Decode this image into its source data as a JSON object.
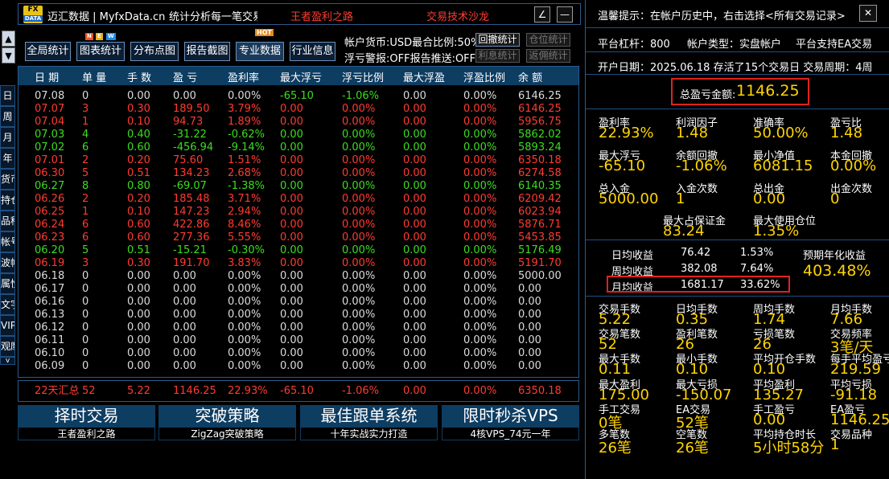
{
  "titlebar": {
    "logo_top": "FX",
    "logo_bottom": "DATA",
    "app_title": "迈汇数据 | MyfxData.cn",
    "subtitle": "统计分析每一笔交易",
    "link1": "王者盈利之路",
    "link2": "交易技术沙龙",
    "btn_edit": "∠",
    "btn_min": "—"
  },
  "nav": {
    "up": "▲",
    "down": "▼"
  },
  "toolbar": {
    "buttons": [
      "全局统计",
      "图表统计",
      "分布点图",
      "报告截图",
      "专业数据",
      "行业信息"
    ],
    "new_badge": [
      "N",
      "E",
      "W"
    ],
    "hot_badge": "HOT",
    "currency_text": "帐户货币:USD最合比例:50%",
    "withdraw_btn": "回撤统计",
    "position_btn": "仓位统计",
    "alert_text": "浮亏警报:OFF报告推送:OFF",
    "interest_btn": "利息统计",
    "commission_btn": "返佣统计"
  },
  "side_tabs": [
    "日",
    "周",
    "月",
    "年",
    "货币",
    "持仓",
    "品种",
    "帐号",
    "波幅",
    "属性",
    "文字",
    "VIP",
    "观摩"
  ],
  "side_tabs_more": "v",
  "table": {
    "headers": [
      "日 期",
      "单 量",
      "手 数",
      "盈 亏",
      "盈利率",
      "最大浮亏",
      "浮亏比例",
      "最大浮盈",
      "浮盈比例",
      "余 额"
    ],
    "rows": [
      {
        "c": "w",
        "v": [
          "07.08",
          "0",
          "0.00",
          "0.00",
          "0.00%",
          "-65.10",
          "-1.06%",
          "0.00",
          "0.00%",
          "6146.25"
        ],
        "g5": true
      },
      {
        "c": "r",
        "v": [
          "07.07",
          "3",
          "0.30",
          "189.50",
          "3.79%",
          "0.00",
          "0.00%",
          "0.00",
          "0.00%",
          "6146.25"
        ]
      },
      {
        "c": "r",
        "v": [
          "07.04",
          "1",
          "0.10",
          "94.73",
          "1.89%",
          "0.00",
          "0.00%",
          "0.00",
          "0.00%",
          "5956.75"
        ]
      },
      {
        "c": "g",
        "v": [
          "07.03",
          "4",
          "0.40",
          "-31.22",
          "-0.62%",
          "0.00",
          "0.00%",
          "0.00",
          "0.00%",
          "5862.02"
        ]
      },
      {
        "c": "g",
        "v": [
          "07.02",
          "6",
          "0.60",
          "-456.94",
          "-9.14%",
          "0.00",
          "0.00%",
          "0.00",
          "0.00%",
          "5893.24"
        ]
      },
      {
        "c": "r",
        "v": [
          "07.01",
          "2",
          "0.20",
          "75.60",
          "1.51%",
          "0.00",
          "0.00%",
          "0.00",
          "0.00%",
          "6350.18"
        ]
      },
      {
        "c": "r",
        "v": [
          "06.30",
          "5",
          "0.51",
          "134.23",
          "2.68%",
          "0.00",
          "0.00%",
          "0.00",
          "0.00%",
          "6274.58"
        ]
      },
      {
        "c": "g",
        "v": [
          "06.27",
          "8",
          "0.80",
          "-69.07",
          "-1.38%",
          "0.00",
          "0.00%",
          "0.00",
          "0.00%",
          "6140.35"
        ]
      },
      {
        "c": "r",
        "v": [
          "06.26",
          "2",
          "0.20",
          "185.48",
          "3.71%",
          "0.00",
          "0.00%",
          "0.00",
          "0.00%",
          "6209.42"
        ]
      },
      {
        "c": "r",
        "v": [
          "06.25",
          "1",
          "0.10",
          "147.23",
          "2.94%",
          "0.00",
          "0.00%",
          "0.00",
          "0.00%",
          "6023.94"
        ]
      },
      {
        "c": "r",
        "v": [
          "06.24",
          "6",
          "0.60",
          "422.86",
          "8.46%",
          "0.00",
          "0.00%",
          "0.00",
          "0.00%",
          "5876.71"
        ]
      },
      {
        "c": "r",
        "v": [
          "06.23",
          "6",
          "0.60",
          "277.36",
          "5.55%",
          "0.00",
          "0.00%",
          "0.00",
          "0.00%",
          "5453.85"
        ]
      },
      {
        "c": "g",
        "v": [
          "06.20",
          "5",
          "0.51",
          "-15.21",
          "-0.30%",
          "0.00",
          "0.00%",
          "0.00",
          "0.00%",
          "5176.49"
        ]
      },
      {
        "c": "r",
        "v": [
          "06.19",
          "3",
          "0.30",
          "191.70",
          "3.83%",
          "0.00",
          "0.00%",
          "0.00",
          "0.00%",
          "5191.70"
        ]
      },
      {
        "c": "w",
        "v": [
          "06.18",
          "0",
          "0.00",
          "0.00",
          "0.00%",
          "0.00",
          "0.00%",
          "0.00",
          "0.00%",
          "5000.00"
        ]
      },
      {
        "c": "w",
        "v": [
          "06.17",
          "0",
          "0.00",
          "0.00",
          "0.00%",
          "0.00",
          "0.00%",
          "0.00",
          "0.00%",
          "0.00"
        ]
      },
      {
        "c": "w",
        "v": [
          "06.16",
          "0",
          "0.00",
          "0.00",
          "0.00%",
          "0.00",
          "0.00%",
          "0.00",
          "0.00%",
          "0.00"
        ]
      },
      {
        "c": "w",
        "v": [
          "06.13",
          "0",
          "0.00",
          "0.00",
          "0.00%",
          "0.00",
          "0.00%",
          "0.00",
          "0.00%",
          "0.00"
        ]
      },
      {
        "c": "w",
        "v": [
          "06.12",
          "0",
          "0.00",
          "0.00",
          "0.00%",
          "0.00",
          "0.00%",
          "0.00",
          "0.00%",
          "0.00"
        ]
      },
      {
        "c": "w",
        "v": [
          "06.11",
          "0",
          "0.00",
          "0.00",
          "0.00%",
          "0.00",
          "0.00%",
          "0.00",
          "0.00%",
          "0.00"
        ]
      },
      {
        "c": "w",
        "v": [
          "06.10",
          "0",
          "0.00",
          "0.00",
          "0.00%",
          "0.00",
          "0.00%",
          "0.00",
          "0.00%",
          "0.00"
        ]
      },
      {
        "c": "w",
        "v": [
          "06.09",
          "0",
          "0.00",
          "0.00",
          "0.00%",
          "0.00",
          "0.00%",
          "0.00",
          "0.00%",
          "0.00"
        ]
      }
    ],
    "summary": [
      "22天汇总",
      "52",
      "5.22",
      "1146.25",
      "22.93%",
      "-65.10",
      "-1.06%",
      "0.00",
      "0.00%",
      "6350.18"
    ]
  },
  "banners": [
    {
      "title": "择时交易",
      "sub": "王者盈利之路"
    },
    {
      "title": "突破策略",
      "sub": "ZigZag突破策略"
    },
    {
      "title": "最佳跟单系统",
      "sub": "十年实战实力打造"
    },
    {
      "title": "限时秒杀VPS",
      "sub": "4核VPS_74元一年"
    }
  ],
  "right": {
    "tip": "温馨提示：在帐户历史中，右击选择<所有交易记录>",
    "close": "✕",
    "leverage": "平台杠杆：800",
    "acct_type": "帐户类型：实盘帐户",
    "ea_support": "平台支持EA交易",
    "open_line": "开户日期：2025.06.18 存活了15个交易日 交易周期：4周",
    "total_label": "总盈亏金额:",
    "total_value": "1146.25",
    "stats1": [
      {
        "l": "盈利率",
        "v": "22.93%"
      },
      {
        "l": "利润因子",
        "v": "1.48"
      },
      {
        "l": "准确率",
        "v": "50.00%"
      },
      {
        "l": "盈亏比",
        "v": "1.48"
      },
      {
        "l": "最大浮亏",
        "v": "-65.10"
      },
      {
        "l": "余额回撤",
        "v": "-1.06%"
      },
      {
        "l": "最小净值",
        "v": "6081.15"
      },
      {
        "l": "本金回撤",
        "v": "0.00%"
      },
      {
        "l": "总入金",
        "v": "5000.00"
      },
      {
        "l": "入金次数",
        "v": "1"
      },
      {
        "l": "总出金",
        "v": "0.00"
      },
      {
        "l": "出金次数",
        "v": "0"
      }
    ],
    "margin_label": "最大占保证金",
    "margin_value": "83.24",
    "maxpos_label": "最大使用仓位",
    "maxpos_value": "1.35%",
    "avg": [
      {
        "l": "日均收益",
        "v": "76.42",
        "p": "1.53%"
      },
      {
        "l": "周均收益",
        "v": "382.08",
        "p": "7.64%"
      },
      {
        "l": "月均收益",
        "v": "1681.17",
        "p": "33.62%"
      }
    ],
    "annual_label": "预期年化收益",
    "annual_value": "403.48%",
    "stats2": [
      {
        "l": "交易手数",
        "v": "5.22"
      },
      {
        "l": "日均手数",
        "v": "0.35"
      },
      {
        "l": "周均手数",
        "v": "1.74"
      },
      {
        "l": "月均手数",
        "v": "7.66"
      },
      {
        "l": "交易笔数",
        "v": "52"
      },
      {
        "l": "盈利笔数",
        "v": "26"
      },
      {
        "l": "亏损笔数",
        "v": "26"
      },
      {
        "l": "交易频率",
        "v": "3笔/天"
      },
      {
        "l": "最大手数",
        "v": "0.11"
      },
      {
        "l": "最小手数",
        "v": "0.10"
      },
      {
        "l": "平均开仓手数",
        "v": "0.10"
      },
      {
        "l": "每手平均盈亏",
        "v": "219.59"
      },
      {
        "l": "最大盈利",
        "v": "175.00"
      },
      {
        "l": "最大亏损",
        "v": "-150.07"
      },
      {
        "l": "平均盈利",
        "v": "135.27"
      },
      {
        "l": "平均亏损",
        "v": "-91.18"
      },
      {
        "l": "手工交易",
        "v": "0笔"
      },
      {
        "l": "EA交易",
        "v": "52笔"
      },
      {
        "l": "手工盈亏",
        "v": "0.00"
      },
      {
        "l": "EA盈亏",
        "v": "1146.25"
      },
      {
        "l": "多笔数",
        "v": "26笔"
      },
      {
        "l": "空笔数",
        "v": "26笔"
      },
      {
        "l": "平均持仓时长",
        "v": "5小时58分"
      },
      {
        "l": "交易品种",
        "v": "1"
      }
    ]
  },
  "colors": {
    "red": "#ff3b30",
    "green": "#3ddc1f",
    "white": "#dcdcdc",
    "yellow": "#ffd400",
    "header_bg": "#0e3d62"
  }
}
